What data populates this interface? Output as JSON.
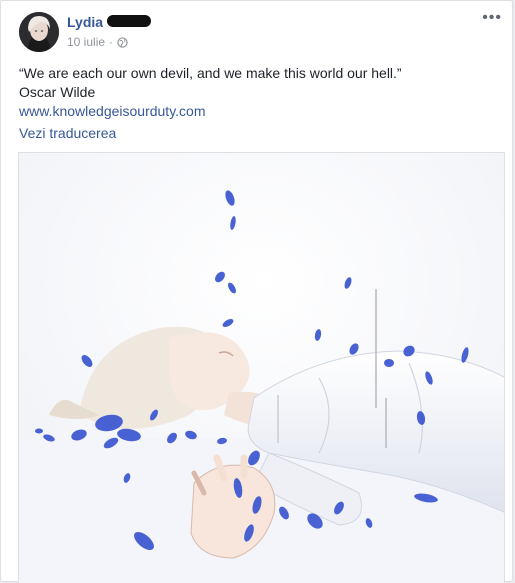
{
  "post": {
    "author_name": "Lydia",
    "date": "10 iulie",
    "date_separator": "·",
    "more_label": "•••",
    "quote": "“We are each our own devil, and we make this world our hell.”",
    "quote_author": "Oscar Wilde",
    "link_text": "www.knowledgeisourduty.com",
    "translate_label": "Vezi traducerea"
  },
  "icons": {
    "privacy": "globe-icon",
    "menu": "more-options-icon"
  },
  "colors": {
    "link": "#365899",
    "meta": "#90949c",
    "text": "#1d2129",
    "petal_blue": "#3a55d0"
  }
}
